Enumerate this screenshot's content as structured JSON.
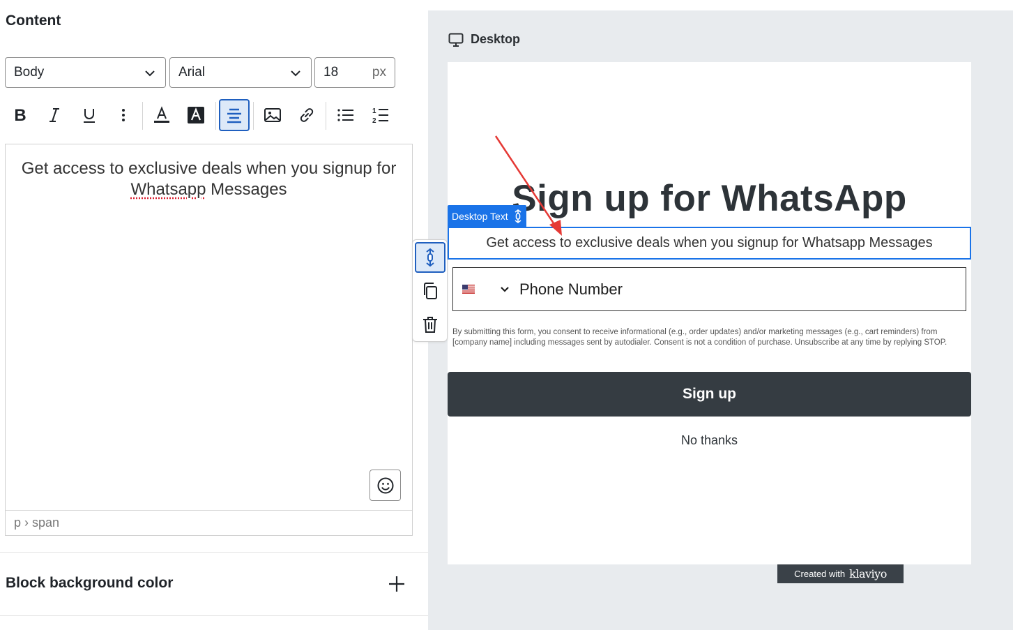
{
  "editor": {
    "section_title": "Content",
    "style_select": {
      "value": "Body"
    },
    "font_select": {
      "value": "Arial"
    },
    "font_size": {
      "value": "18",
      "unit": "px"
    },
    "toolbar": {
      "buttons": [
        "bold",
        "italic",
        "underline",
        "more",
        "text-color",
        "highlight-color",
        "align-center",
        "insert-image",
        "insert-link",
        "bulleted-list",
        "numbered-list"
      ],
      "active": "align-center"
    },
    "text": {
      "before": "Get access to exclusive deals when you signup for ",
      "misspelled": "Whatsapp",
      "after": " Messages"
    },
    "path": "p › span",
    "block_background_label": "Block background color"
  },
  "preview": {
    "device_label": "Desktop",
    "heading": "Sign up for WhatsApp",
    "selected_block_tag": "Desktop Text",
    "subtext": "Get access to exclusive deals when you signup for Whatsapp Messages",
    "phone_placeholder": "Phone Number",
    "consent": "By submitting this form, you consent to receive informational (e.g., order updates) and/or marketing messages (e.g., cart reminders) from [company name] including messages sent by autodialer. Consent is not a condition of purchase. Unsubscribe at any time by replying STOP.",
    "signup_label": "Sign up",
    "no_thanks_label": "No thanks",
    "created_with": "Created with",
    "brand": "klaviyo"
  },
  "colors": {
    "accent_blue": "#1a73e8",
    "button_dark": "#353c42",
    "annotation_red": "#e53935",
    "canvas_bg": "#e8ebee"
  }
}
